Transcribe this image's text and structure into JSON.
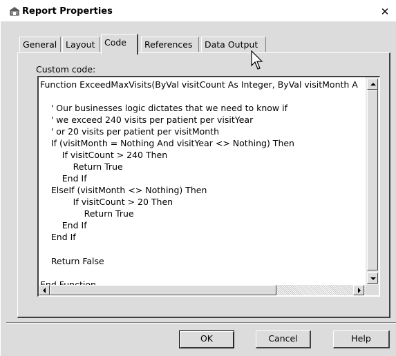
{
  "window": {
    "title": "Report Properties",
    "close_glyph": "✕"
  },
  "tabs": [
    {
      "label": "General",
      "active": false
    },
    {
      "label": "Layout",
      "active": false
    },
    {
      "label": "Code",
      "active": true
    },
    {
      "label": "References",
      "active": false
    },
    {
      "label": "Data Output",
      "active": false
    }
  ],
  "custom_code_label": "Custom code:",
  "code_lines": [
    "Function ExceedMaxVisits(ByVal visitCount As Integer, ByVal visitMonth A",
    "",
    "    ' Our businesses logic dictates that we need to know if",
    "    ' we exceed 240 visits per patient per visitYear",
    "    ' or 20 visits per patient per visitMonth",
    "    If (visitMonth = Nothing And visitYear <> Nothing) Then",
    "        If visitCount > 240 Then",
    "            Return True",
    "        End If",
    "    ElseIf (visitMonth <> Nothing) Then",
    "            If visitCount > 20 Then",
    "                Return True",
    "        End If",
    "    End If",
    "",
    "    Return False",
    "",
    "End Function"
  ],
  "buttons": {
    "ok": "OK",
    "cancel": "Cancel",
    "help": "Help"
  },
  "icons": {
    "app": "report-properties-icon",
    "close": "close-icon",
    "scroll_up": "scroll-up-arrow-icon",
    "scroll_down": "scroll-down-arrow-icon",
    "scroll_left": "scroll-left-arrow-icon",
    "scroll_right": "scroll-right-arrow-icon",
    "cursor": "mouse-pointer-icon"
  },
  "colors": {
    "dialog_bg": "#dcdcdc",
    "code_bg": "#ffffff",
    "text": "#000000"
  }
}
